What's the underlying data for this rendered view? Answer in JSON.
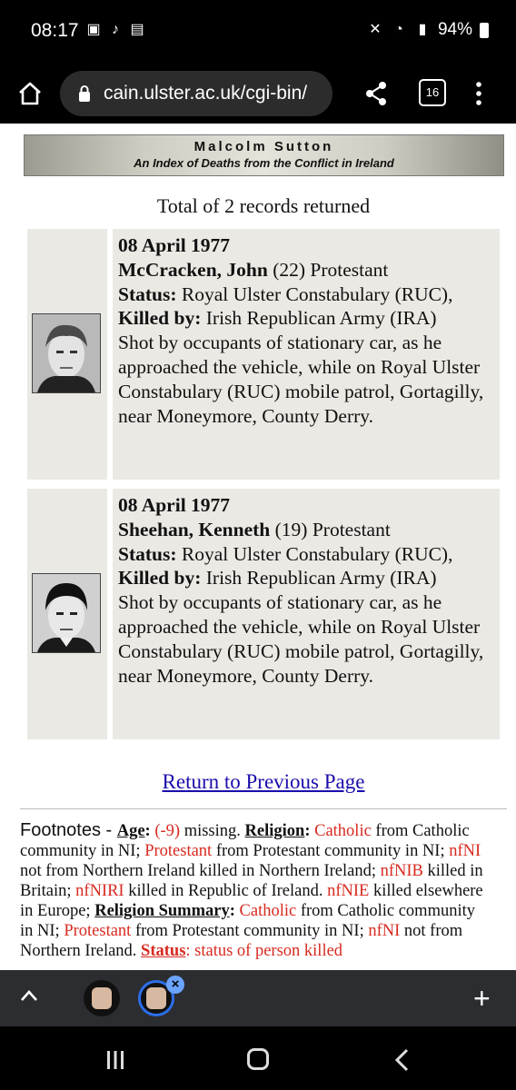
{
  "status": {
    "time": "08:17",
    "battery": "94%",
    "icons": [
      "gallery-icon",
      "tiktok-icon",
      "voicemail-icon",
      "mute-icon",
      "wifi-icon",
      "signal-icon",
      "battery-icon"
    ]
  },
  "browser": {
    "url": "cain.ulster.ac.uk/cgi-bin/",
    "tab_count": "16"
  },
  "banner": {
    "title": "Malcolm Sutton",
    "subtitle": "An Index of Deaths from the Conflict in Ireland"
  },
  "results": {
    "total": "Total of 2 records returned",
    "records": [
      {
        "date": "08 April 1977",
        "name": "McCracken, John",
        "age_religion": " (22) Protestant",
        "status_label": "Status:",
        "status_value": " Royal Ulster Constabulary (RUC), ",
        "killed_label": "Killed by:",
        "killed_value": " Irish Republican Army (IRA)",
        "description": "Shot by occupants of stationary car, as he approached the vehicle, while on Royal Ulster Constabulary (RUC) mobile patrol, Gortagilly, near Moneymore, County Derry."
      },
      {
        "date": "08 April 1977",
        "name": "Sheehan, Kenneth",
        "age_religion": " (19) Protestant",
        "status_label": "Status:",
        "status_value": " Royal Ulster Constabulary (RUC), ",
        "killed_label": "Killed by:",
        "killed_value": " Irish Republican Army (IRA)",
        "description": "Shot by occupants of stationary car, as he approached the vehicle, while on Royal Ulster Constabulary (RUC) mobile patrol, Gortagilly, near Moneymore, County Derry."
      }
    ]
  },
  "return_link": "Return to Previous Page",
  "footnotes": {
    "heading": "Footnotes - ",
    "age_label": "Age",
    "age_code": "(-9)",
    "age_text": " missing. ",
    "religion_label": "Religion",
    "catholic": "Catholic",
    "catholic_text": " from Catholic community in NI; ",
    "protestant": "Protestant",
    "protestant_text": " from Protestant community in NI; ",
    "nfni": "nfNI",
    "nfni_text": " not from Northern Ireland killed in Northern Ireland; ",
    "nfnib": "nfNIB",
    "nfnib_text": " killed in Britain; ",
    "nfniri": "nfNIRI",
    "nfniri_text": " killed in Republic of Ireland. ",
    "nfnie": "nfNIE",
    "nfnie_text": " killed elsewhere in Europe; ",
    "religion_summary_label": "Religion Summary",
    "rs_catholic": "Catholic",
    "rs_catholic_text": " from Catholic community in NI; ",
    "rs_protestant": "Protestant",
    "rs_protestant_text": " from Protestant community in NI; ",
    "rs_nfni": "nfNI",
    "rs_nfni_text": " not from Northern Ireland. ",
    "status_label": "Status",
    "status_text": " status of person killed"
  },
  "colors": {
    "link": "#1a0dab",
    "code_red": "#d82a20",
    "record_bg": "#ebe9e4"
  }
}
